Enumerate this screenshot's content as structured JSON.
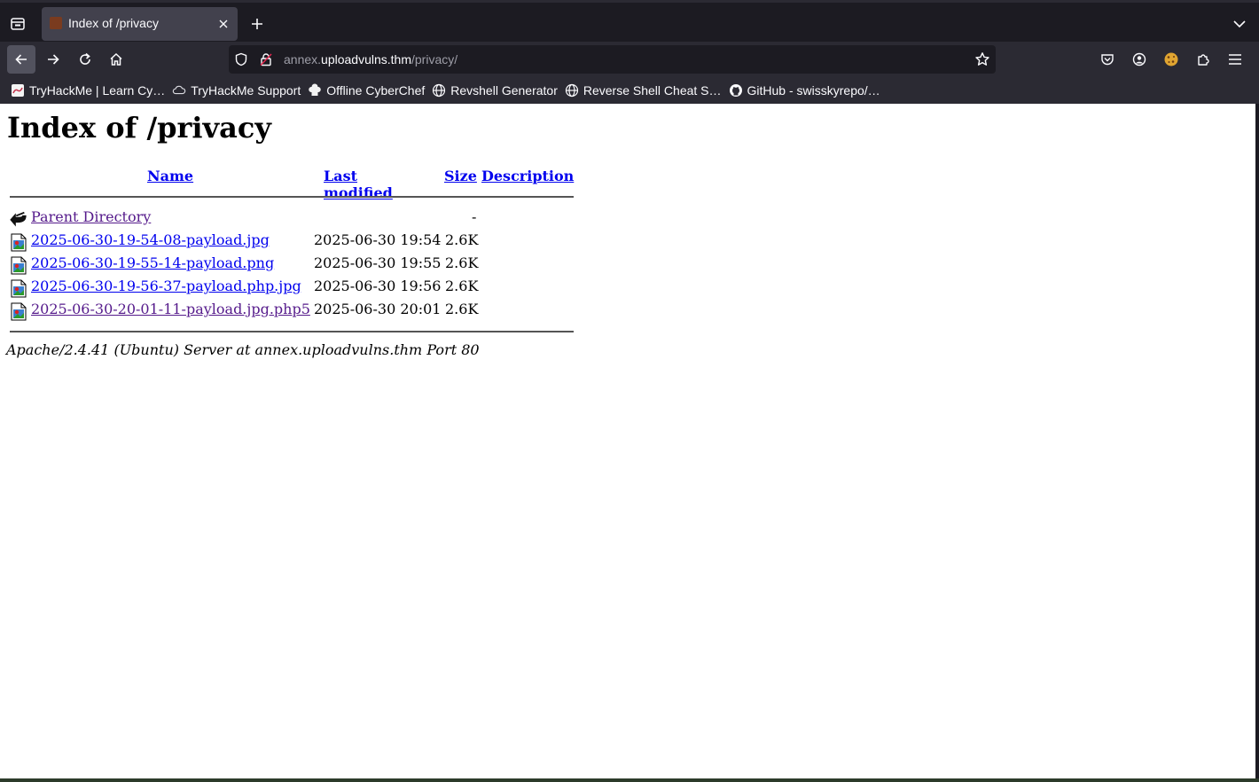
{
  "browser": {
    "tab_title": "Index of /privacy",
    "url": {
      "subdomain": "annex.",
      "host": "uploadvulns.thm",
      "path": "/privacy/"
    },
    "bookmarks": [
      {
        "label": "TryHackMe | Learn Cy…",
        "icon": "tryhackme-icon"
      },
      {
        "label": "TryHackMe Support",
        "icon": "cloud-icon"
      },
      {
        "label": "Offline CyberChef",
        "icon": "chef-hat-icon"
      },
      {
        "label": "Revshell Generator",
        "icon": "globe-icon"
      },
      {
        "label": "Reverse Shell Cheat S…",
        "icon": "globe-icon"
      },
      {
        "label": "GitHub - swisskyrepo/…",
        "icon": "github-icon"
      }
    ]
  },
  "page": {
    "title": "Index of /privacy",
    "columns": {
      "name": "Name",
      "last_modified": "Last modified",
      "size": "Size",
      "description": "Description"
    },
    "parent": {
      "label": "Parent Directory",
      "size": "-"
    },
    "files": [
      {
        "name": "2025-06-30-19-54-08-payload.jpg",
        "modified": "2025-06-30 19:54",
        "size": "2.6K"
      },
      {
        "name": "2025-06-30-19-55-14-payload.png",
        "modified": "2025-06-30 19:55",
        "size": "2.6K"
      },
      {
        "name": "2025-06-30-19-56-37-payload.php.jpg",
        "modified": "2025-06-30 19:56",
        "size": "2.6K"
      },
      {
        "name": "2025-06-30-20-01-11-payload.jpg.php5",
        "modified": "2025-06-30 20:01",
        "size": "2.6K"
      }
    ],
    "address": "Apache/2.4.41 (Ubuntu) Server at annex.uploadvulns.thm Port 80"
  },
  "colors": {
    "link": "#0000ee",
    "visited_link": "#551a8b",
    "chrome_dark": "#1c1b22",
    "chrome_toolbar": "#2b2a33"
  }
}
